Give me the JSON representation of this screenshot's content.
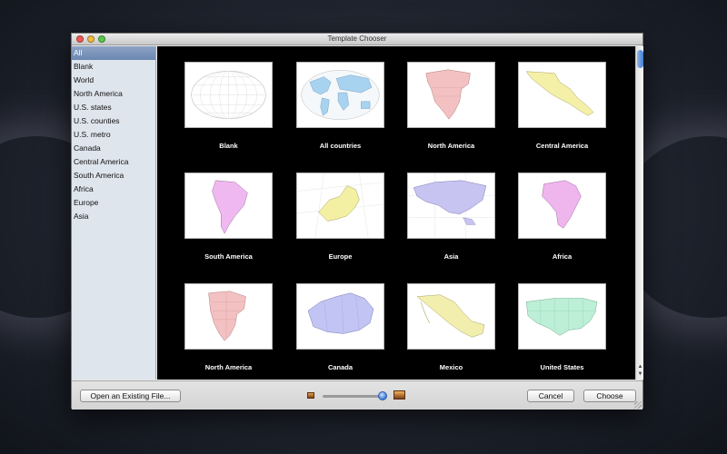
{
  "window": {
    "title": "Template Chooser"
  },
  "sidebar": {
    "items": [
      {
        "label": "All",
        "selected": true
      },
      {
        "label": "Blank"
      },
      {
        "label": "World"
      },
      {
        "label": "North America"
      },
      {
        "label": "U.S. states"
      },
      {
        "label": "U.S. counties"
      },
      {
        "label": "U.S. metro"
      },
      {
        "label": "Canada"
      },
      {
        "label": "Central America"
      },
      {
        "label": "South America"
      },
      {
        "label": "Africa"
      },
      {
        "label": "Europe"
      },
      {
        "label": "Asia"
      }
    ]
  },
  "templates": [
    {
      "label": "Blank",
      "icon": "blank-map-icon",
      "color": "#ffffff"
    },
    {
      "label": "All countries",
      "icon": "world-map-icon",
      "color": "#a8d3f0"
    },
    {
      "label": "North America",
      "icon": "north-america-map-icon",
      "color": "#f3c1c1"
    },
    {
      "label": "Central America",
      "icon": "central-america-map-icon",
      "color": "#f5f0a8"
    },
    {
      "label": "South America",
      "icon": "south-america-map-icon",
      "color": "#f0b8f0"
    },
    {
      "label": "Europe",
      "icon": "europe-map-icon",
      "color": "#f3f0a4"
    },
    {
      "label": "Asia",
      "icon": "asia-map-icon",
      "color": "#c8c4f2"
    },
    {
      "label": "Africa",
      "icon": "africa-map-icon",
      "color": "#efb6ee"
    },
    {
      "label": "North America",
      "icon": "north-america-states-map-icon",
      "color": "#f3c1c1"
    },
    {
      "label": "Canada",
      "icon": "canada-map-icon",
      "color": "#c2c4f3"
    },
    {
      "label": "Mexico",
      "icon": "mexico-map-icon",
      "color": "#f2efae"
    },
    {
      "label": "United States",
      "icon": "united-states-map-icon",
      "color": "#bcefd6"
    }
  ],
  "bottom": {
    "open_label": "Open an Existing File...",
    "cancel_label": "Cancel",
    "choose_label": "Choose",
    "thumbnail_size_percent": 95
  }
}
